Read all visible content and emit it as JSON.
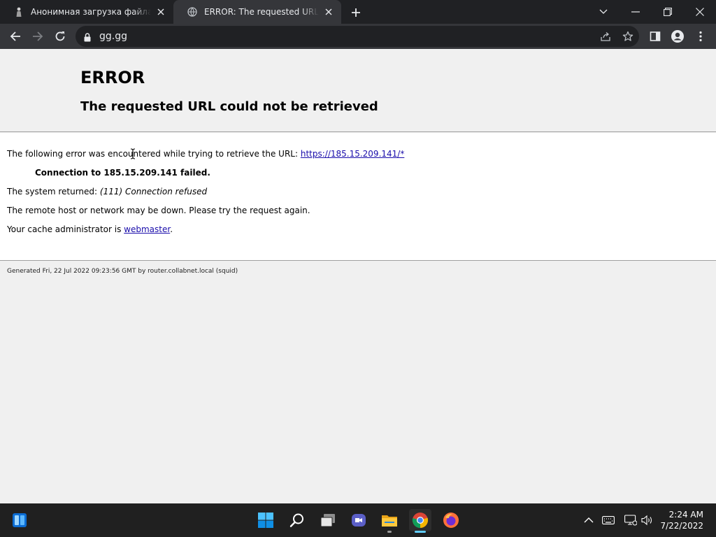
{
  "browser": {
    "tabs": [
      {
        "title": "Анонимная загрузка файла - Ан",
        "active": false,
        "favicon": "person-icon"
      },
      {
        "title": "ERROR: The requested URL could",
        "active": true,
        "favicon": "globe-icon"
      }
    ],
    "address": {
      "url": "gg.gg"
    }
  },
  "page": {
    "heading": "ERROR",
    "subheading": "The requested URL could not be retrieved",
    "line1_text": "The following error was encountered while trying to retrieve the URL: ",
    "line1_link": "https://185.15.209.141/*",
    "failed_text": "Connection to 185.15.209.141 failed.",
    "system_prefix": "The system returned: ",
    "system_error": "(111) Connection refused",
    "remote_text": "The remote host or network may be down. Please try the request again.",
    "admin_prefix": "Your cache administrator is ",
    "admin_link": "webmaster",
    "admin_suffix": ".",
    "footer": "Generated Fri, 22 Jul 2022 09:23:56 GMT by router.collabnet.local (squid)"
  },
  "taskbar": {
    "clock_time": "2:24 AM",
    "clock_date": "7/22/2022",
    "apps": [
      "start-icon",
      "search-icon",
      "task-view-icon",
      "chat-icon",
      "file-explorer-icon",
      "chrome-icon",
      "firefox-icon"
    ]
  },
  "colors": {
    "link": "#1a0dab",
    "tab_bar": "#202124",
    "toolbar": "#35363a",
    "taskbar": "#202020",
    "accent": "#60cdff"
  }
}
